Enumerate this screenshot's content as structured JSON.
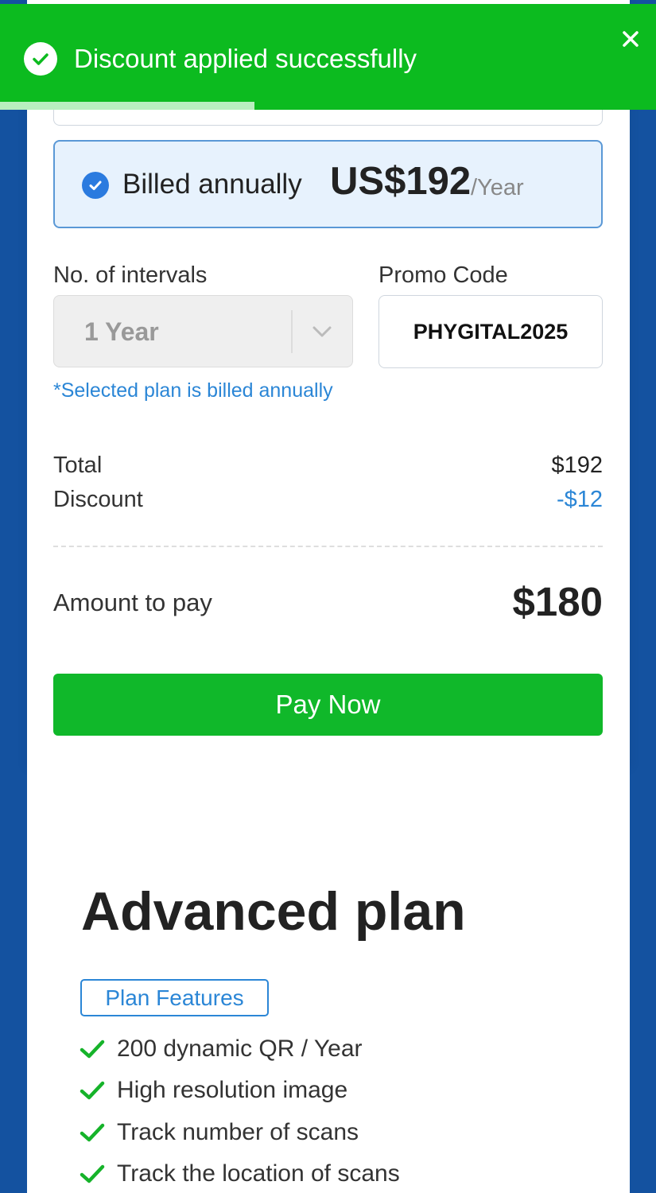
{
  "toast": {
    "message": "Discount applied successfully",
    "close_icon": "close-icon",
    "check_icon": "check-circle-icon"
  },
  "billing": {
    "label": "Billed annually",
    "price": "US$192",
    "unit": "/Year",
    "selected": true
  },
  "intervals": {
    "label": "No. of intervals",
    "value": "1 Year"
  },
  "promo": {
    "label": "Promo Code",
    "value": "PHYGITAL2025"
  },
  "note": "*Selected plan is billed annually",
  "summary": {
    "total_label": "Total",
    "total_value": "$192",
    "discount_label": "Discount",
    "discount_value": "-$12",
    "amount_label": "Amount to pay",
    "amount_value": "$180"
  },
  "pay_button": "Pay Now",
  "plan": {
    "title": "Advanced plan",
    "features_badge": "Plan Features",
    "features": [
      "200 dynamic QR / Year",
      "High resolution image",
      "Track number of scans",
      "Track the location of scans"
    ]
  },
  "colors": {
    "toast_green": "#0cbb1f",
    "pay_green": "#10b82a",
    "accent_blue": "#2b86d6",
    "background_blue": "#1452a0"
  }
}
